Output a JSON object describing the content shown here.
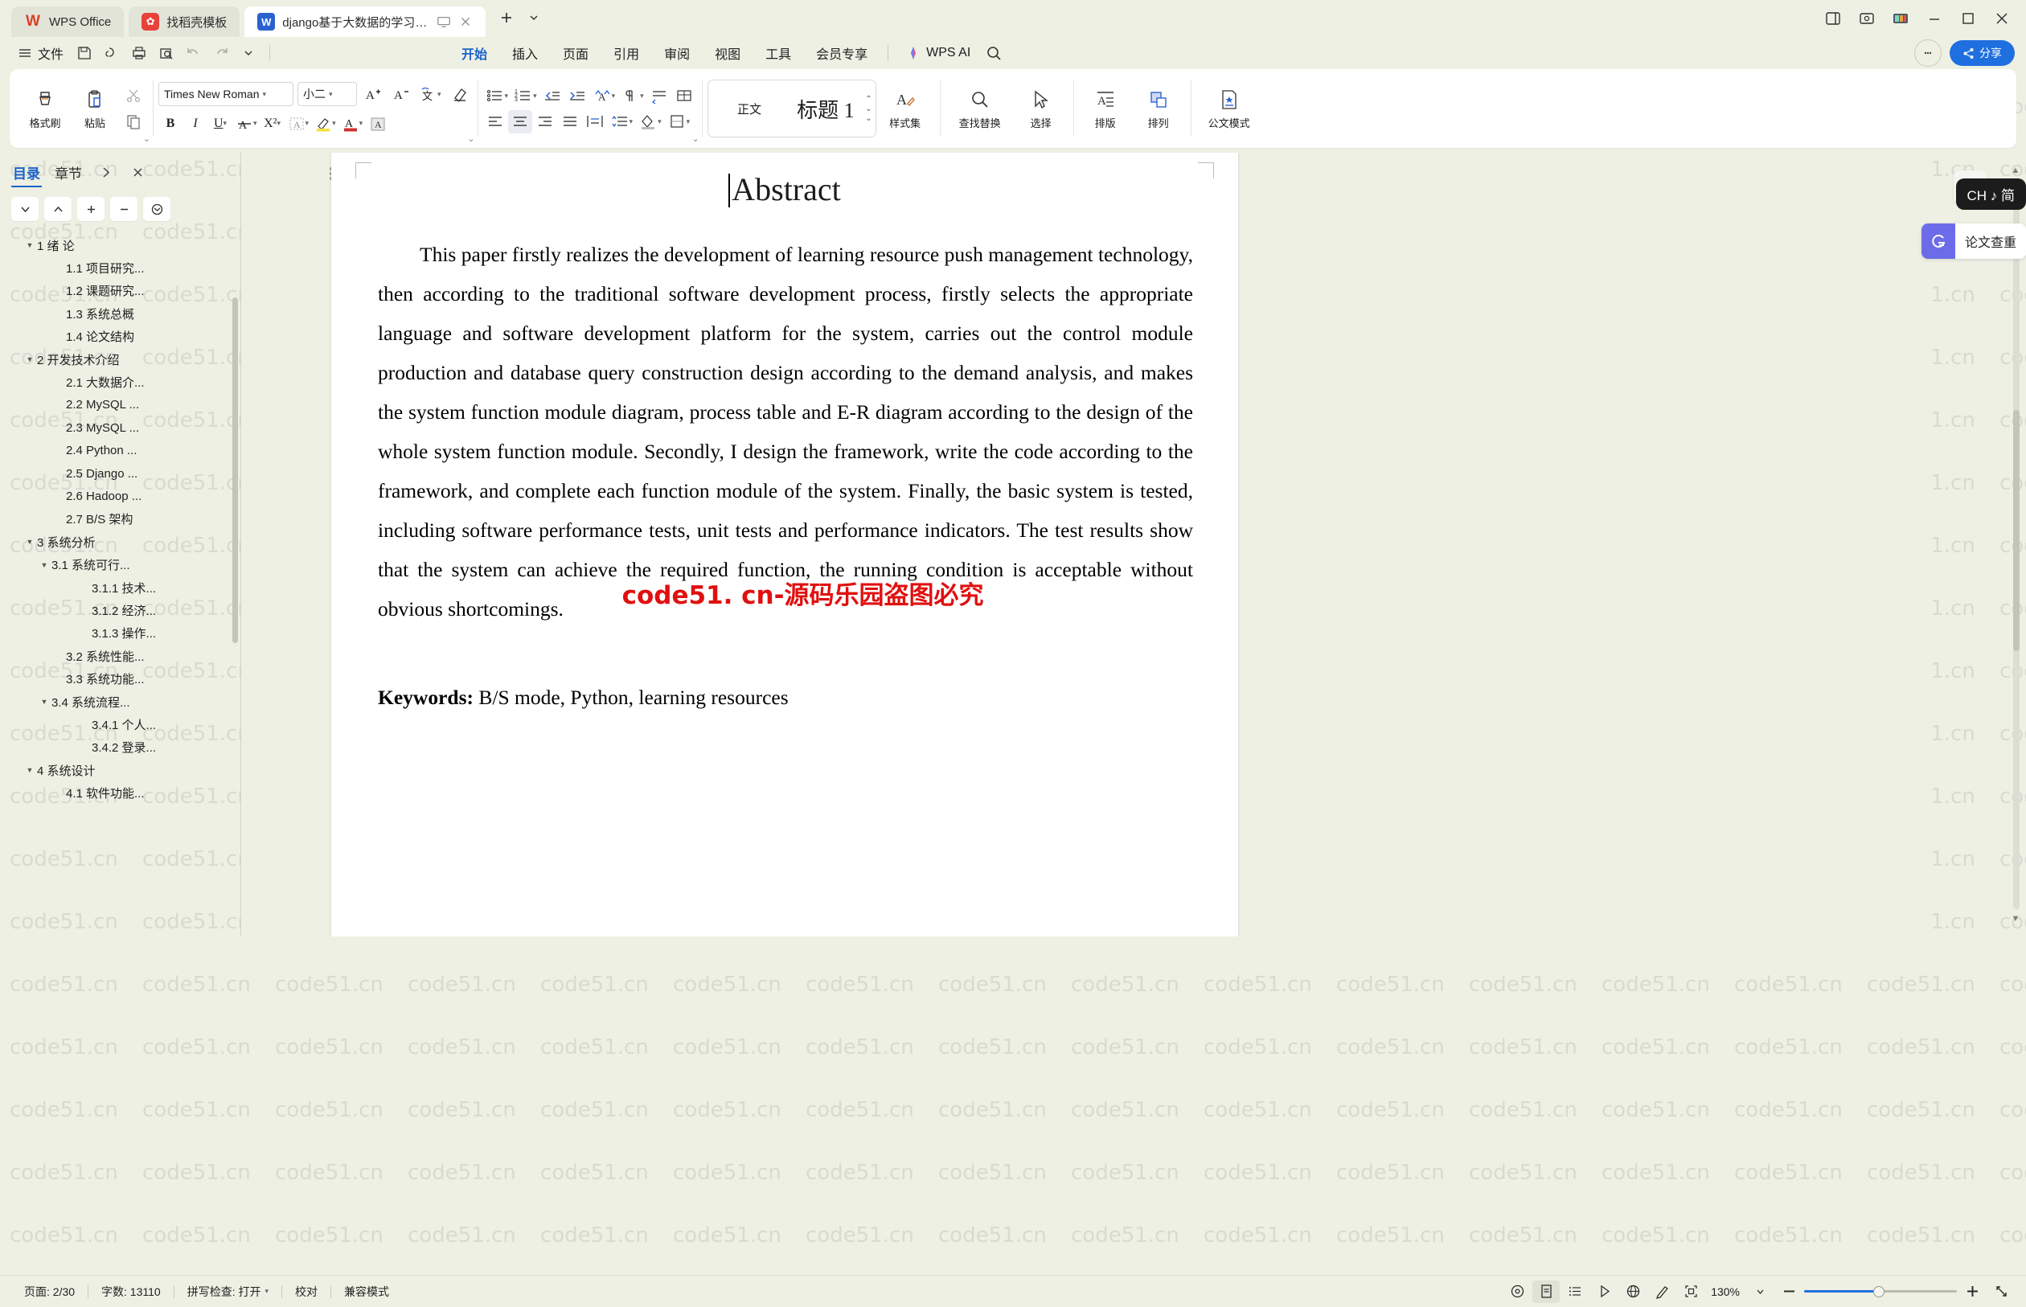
{
  "titlebar": {
    "tabs": [
      {
        "label": "WPS Office",
        "icon": "wps-logo-icon",
        "active": false
      },
      {
        "label": "找稻壳模板",
        "icon": "docer-icon",
        "active": false
      },
      {
        "label": "django基于大数据的学习资源",
        "icon": "word-doc-icon",
        "active": true
      }
    ],
    "new_tab": "+",
    "tab_list_caret": "⌄",
    "window_buttons": [
      "side-panel-icon",
      "cast-icon",
      "screenshot-icon",
      "minimize-icon",
      "maximize-icon",
      "close-icon"
    ]
  },
  "menubar": {
    "file_label": "文件",
    "quick_access": [
      "save-icon",
      "undo-search-icon",
      "print-icon",
      "print-preview-icon",
      "undo-icon",
      "redo-icon",
      "customize-caret-icon"
    ],
    "tabs": [
      {
        "label": "开始",
        "active": true
      },
      {
        "label": "插入",
        "active": false
      },
      {
        "label": "页面",
        "active": false
      },
      {
        "label": "引用",
        "active": false
      },
      {
        "label": "审阅",
        "active": false
      },
      {
        "label": "视图",
        "active": false
      },
      {
        "label": "工具",
        "active": false
      },
      {
        "label": "会员专享",
        "active": false
      }
    ],
    "ai_label": "WPS AI",
    "search_icon": "search-icon",
    "help_icon": "help-icon",
    "share_label": "分享"
  },
  "ribbon": {
    "format_painter": "格式刷",
    "paste": "粘贴",
    "cut_icon": "scissors-icon",
    "copy_icon": "copy-icon",
    "font_name": "Times New Roman",
    "font_size": "小二",
    "grow_font_icon": "increase-font-icon",
    "shrink_font_icon": "decrease-font-icon",
    "pinyin_icon": "pinyin-guide-icon",
    "clear_format_icon": "clear-format-icon",
    "bold": "B",
    "italic": "I",
    "underline": "U",
    "strike_icon": "strikethrough-icon",
    "superscript": "X²",
    "char_border_icon": "char-border-icon",
    "highlight_icon": "highlight-color-icon",
    "font_color_icon": "font-color-icon",
    "char_shading_icon": "char-shading-icon",
    "bullets_icon": "bullet-list-icon",
    "numbering_icon": "numbered-list-icon",
    "outdent_icon": "decrease-indent-icon",
    "indent_icon": "increase-indent-icon",
    "sort_icon": "sort-icon",
    "format_marks_icon": "show-marks-icon",
    "align_distribute_icon": "distribute-icon",
    "fields_icon": "insert-field-icon",
    "align_left_icon": "align-left-icon",
    "align_center_icon": "align-center-icon",
    "align_right_icon": "align-right-icon",
    "align_justify_icon": "align-justify-icon",
    "align_distribute2_icon": "align-distributed-icon",
    "line_spacing_icon": "line-spacing-icon",
    "shading_icon": "paragraph-shading-icon",
    "borders_icon": "borders-icon",
    "styles": [
      {
        "label": "正文",
        "selected": false
      },
      {
        "label": "标题 1",
        "selected": true
      }
    ],
    "style_set": "样式集",
    "find_replace": "查找替换",
    "select": "选择",
    "typeset": "排版",
    "arrange": "排列",
    "official_doc_mode": "公文模式"
  },
  "sidebar": {
    "tabs": [
      {
        "label": "目录",
        "active": true
      },
      {
        "label": "章节",
        "active": false
      }
    ],
    "collapse_icon": "chevron-right-icon",
    "close_icon": "close-icon",
    "tools": [
      "expand-down-icon",
      "collapse-up-icon",
      "plus-icon",
      "minus-icon",
      "refresh-icon"
    ],
    "tree": [
      {
        "label": "1 绪  论",
        "level": 1,
        "arrow": "▼"
      },
      {
        "label": "1.1 项目研究...",
        "level": 2,
        "arrow": ""
      },
      {
        "label": "1.2 课题研究...",
        "level": 2,
        "arrow": ""
      },
      {
        "label": "1.3 系统总概",
        "level": 2,
        "arrow": ""
      },
      {
        "label": "1.4 论文结构",
        "level": 2,
        "arrow": ""
      },
      {
        "label": "2 开发技术介绍",
        "level": 1,
        "arrow": "▼"
      },
      {
        "label": "2.1 大数据介...",
        "level": 2,
        "arrow": ""
      },
      {
        "label": "2.2 MySQL ...",
        "level": 2,
        "arrow": ""
      },
      {
        "label": "2.3 MySQL ...",
        "level": 2,
        "arrow": ""
      },
      {
        "label": "2.4 Python ...",
        "level": 2,
        "arrow": ""
      },
      {
        "label": "2.5 Django ...",
        "level": 2,
        "arrow": ""
      },
      {
        "label": "2.6 Hadoop ...",
        "level": 2,
        "arrow": ""
      },
      {
        "label": "2.7 B/S 架构",
        "level": 2,
        "arrow": ""
      },
      {
        "label": "3 系统分析",
        "level": 1,
        "arrow": "▼"
      },
      {
        "label": "3.1 系统可行...",
        "level": 2,
        "arrow": "▼"
      },
      {
        "label": "3.1.1 技术...",
        "level": 3,
        "arrow": ""
      },
      {
        "label": "3.1.2 经济...",
        "level": 3,
        "arrow": ""
      },
      {
        "label": "3.1.3 操作...",
        "level": 3,
        "arrow": ""
      },
      {
        "label": "3.2 系统性能...",
        "level": 2,
        "arrow": ""
      },
      {
        "label": "3.3 系统功能...",
        "level": 2,
        "arrow": ""
      },
      {
        "label": "3.4 系统流程...",
        "level": 2,
        "arrow": "▼"
      },
      {
        "label": "3.4.1 个人...",
        "level": 3,
        "arrow": ""
      },
      {
        "label": "3.4.2 登录...",
        "level": 3,
        "arrow": ""
      },
      {
        "label": "4 系统设计",
        "level": 1,
        "arrow": "▼"
      },
      {
        "label": "4.1 软件功能...",
        "level": 2,
        "arrow": ""
      }
    ]
  },
  "document": {
    "heading": "Abstract",
    "paragraph": "This paper firstly realizes the development of learning resource push management technology, then according to the traditional software development process, firstly selects the appropriate language and software development platform for the system, carries out the control module production and database query construction design according to the demand analysis, and makes the system function module diagram, process table and E-R diagram according to the design of the whole system function module. Secondly, I design the framework, write the code according to the framework, and complete each function module of the system. Finally, the basic system is tested, including software performance tests, unit tests and performance indicators. The test results show that the system can achieve the required function, the running condition is acceptable without obvious shortcomings.",
    "keywords_label": "Keywords:",
    "keywords_value": " B/S mode, Python, learning resources",
    "red_watermark": "code51. cn-源码乐园盗图必究",
    "page_watermark": "code51.cn"
  },
  "right_rail": {
    "panel_toggle_icon": "eject-panel-icon",
    "ime_label": "CH ♪ 简",
    "check_tool_label": "论文查重",
    "check_tool_icon": "plagiarism-check-icon"
  },
  "statusbar": {
    "page": "页面: 2/30",
    "words": "字数: 13110",
    "spellcheck": "拼写检查: 打开",
    "proofread": "校对",
    "compat_mode": "兼容模式",
    "view_icons": [
      "focus-mode-icon",
      "page-view-icon",
      "outline-view-icon",
      "read-mode-icon",
      "web-view-icon",
      "ink-icon",
      "fullscreen-icon"
    ],
    "zoom_level": "130%",
    "zoom_out_icon": "minus-icon",
    "zoom_in_icon": "plus-icon",
    "expand_icon": "expand-arrows-icon"
  }
}
